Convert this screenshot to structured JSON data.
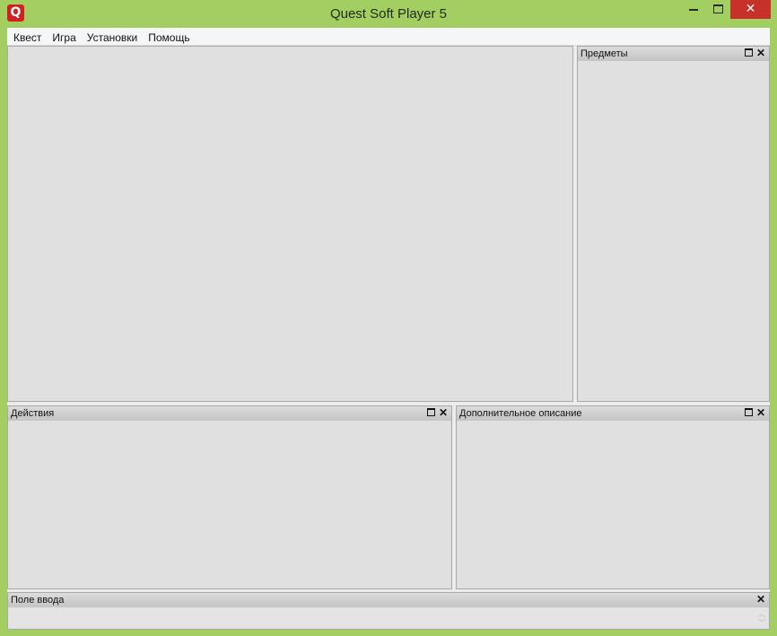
{
  "window": {
    "title": "Quest Soft Player 5",
    "app_icon_letter": "Q",
    "accent_color": "#a3cf62",
    "close_button_color": "#c7312a"
  },
  "menu": {
    "items": [
      {
        "label": "Квест"
      },
      {
        "label": "Игра"
      },
      {
        "label": "Установки"
      },
      {
        "label": "Помощь"
      }
    ]
  },
  "panels": {
    "items": {
      "title": "Предметы"
    },
    "actions": {
      "title": "Действия"
    },
    "extra_description": {
      "title": "Дополнительное описание"
    },
    "input": {
      "title": "Поле ввода",
      "value": ""
    }
  }
}
